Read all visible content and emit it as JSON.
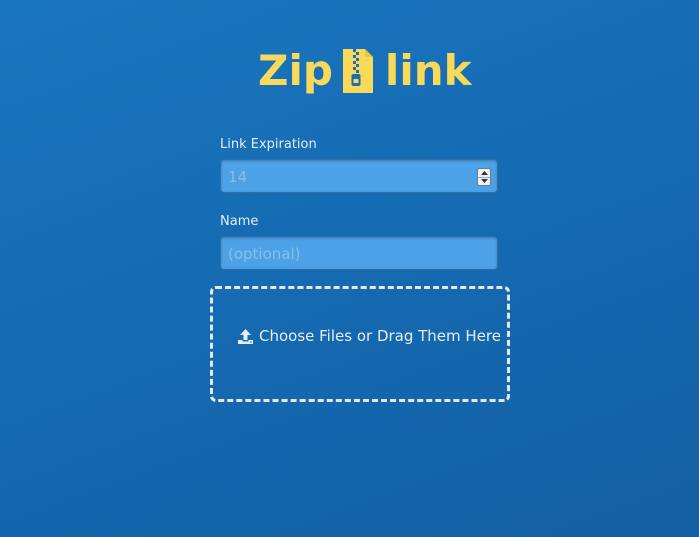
{
  "brand": {
    "word_left": "Zip",
    "word_right": "link",
    "icon": "zip-file-icon",
    "color": "#f9d95a"
  },
  "form": {
    "expiration": {
      "label": "Link Expiration",
      "value": "14"
    },
    "name": {
      "label": "Name",
      "placeholder": "(optional)"
    }
  },
  "upload": {
    "label": "Choose Files or Drag Them Here",
    "icon": "upload-icon"
  }
}
